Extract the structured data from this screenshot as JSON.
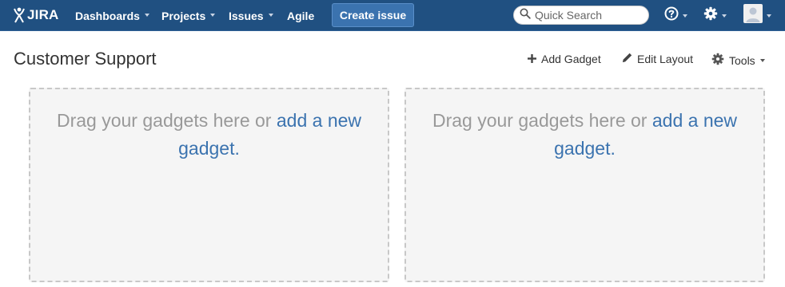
{
  "header": {
    "logo_text": "JIRA",
    "nav": {
      "dashboards": "Dashboards",
      "projects": "Projects",
      "issues": "Issues",
      "agile": "Agile"
    },
    "create_label": "Create issue",
    "search_placeholder": "Quick Search",
    "icons": [
      "atlassian-logo-icon",
      "help-icon",
      "gear-icon",
      "avatar-icon",
      "chevron-down-icon"
    ]
  },
  "page": {
    "title": "Customer Support",
    "tools": {
      "add_gadget": "Add Gadget",
      "edit_layout": "Edit Layout",
      "tools": "Tools"
    }
  },
  "columns": [
    {
      "text": "Drag your gadgets here or ",
      "link": "add a new gadget."
    },
    {
      "text": "Drag your gadgets here or ",
      "link": "add a new gadget."
    }
  ],
  "colors": {
    "header_bg": "#205081",
    "create_button": "#3b73af",
    "link": "#3b73af",
    "drop_zone_bg": "#f5f5f5"
  }
}
